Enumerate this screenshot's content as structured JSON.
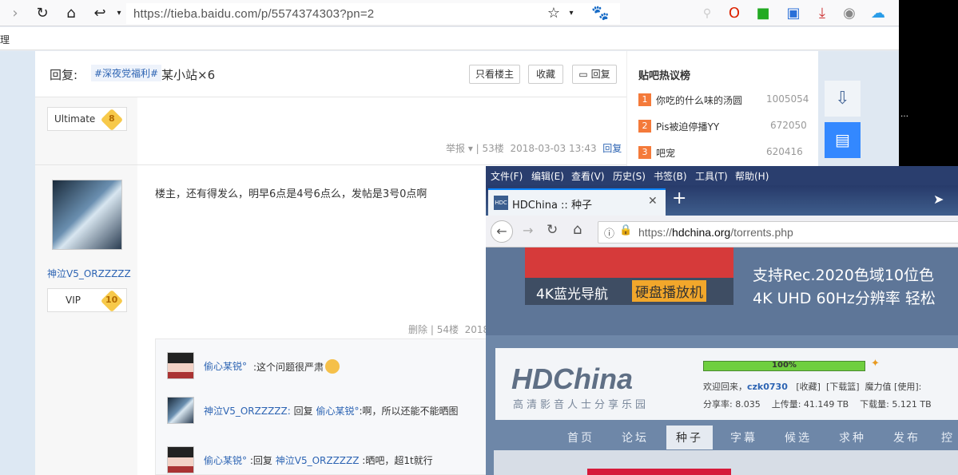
{
  "browser": {
    "url": "https://tieba.baidu.com/p/5574374303?pn=2",
    "menu_char": "理"
  },
  "post": {
    "reply_label": "回复:",
    "topic_tag": "#深夜党福利#",
    "title": "某小站×6",
    "btn_only_op": "只看楼主",
    "btn_favorite": "收藏",
    "btn_reply": "回复"
  },
  "floor53": {
    "badge_label": "Ultimate",
    "badge_level": "8",
    "report": "举报",
    "floor": "53楼",
    "time": "2018-03-03 13:43",
    "reply": "回复"
  },
  "floor54": {
    "username": "神泣V5_ORZZZZZ",
    "badge_label": "VIP",
    "badge_level": "10",
    "content": "楼主，还有得发么，明早6点是4号6点么，发帖是3号0点啊",
    "delete": "删除",
    "floor": "54楼",
    "time_partial": "2018"
  },
  "comments": [
    {
      "user": "偷心某锐°",
      "sep": ":",
      "text": "这个问题很严肃"
    },
    {
      "user": "神泣V5_ORZZZZZ:",
      "prefix": "回复",
      "target": "偷心某锐°",
      "text": ":啊，所以还能不能晒图"
    },
    {
      "user": "偷心某锐°",
      "sep": ":",
      "prefix": "回复",
      "target": "神泣V5_ORZZZZZ",
      "text": ":晒吧，超1t就行"
    }
  ],
  "hot": {
    "title": "贴吧热议榜",
    "items": [
      {
        "rank": "1",
        "label": "你吃的什么味的汤圆",
        "count": "1005054",
        "color": "#f47a3a"
      },
      {
        "rank": "2",
        "label": "Pis被迫停播YY",
        "count": "672050",
        "color": "#f47a3a"
      },
      {
        "rank": "3",
        "label": "吧宠",
        "count": "620416",
        "color": "#f47a3a"
      }
    ]
  },
  "front_browser": {
    "menu": [
      "文件(F)",
      "编辑(E)",
      "查看(V)",
      "历史(S)",
      "书签(B)",
      "工具(T)",
      "帮助(H)"
    ],
    "tab_title": "HDChina :: 种子",
    "url_prefix": "https://",
    "url_domain": "hdchina.org",
    "url_path": "/torrents.php",
    "ad_line1": "4K蓝光导航",
    "ad_highlight": "硬盘播放机",
    "ad_right1": "支持Rec.2020色域10位色",
    "ad_right2": "4K UHD 60Hz分辨率  轻松",
    "logo_text": "HDChina",
    "logo_sub": "高清影音人士分享乐园",
    "progress": "100%",
    "progress_value": 100,
    "welcome": "欢迎回来，",
    "user": "czk0730",
    "links": [
      "[收藏]",
      "[下载篮]",
      "魔力值 [使用]:"
    ],
    "ratio_label": "分享率: 8.035",
    "upload_label": "上传量: 41.149 TB",
    "download_label": "下载量: 5.121 TB",
    "nav": [
      "首页",
      "论坛",
      "种子",
      "字幕",
      "候选",
      "求种",
      "发布",
      "控"
    ]
  }
}
